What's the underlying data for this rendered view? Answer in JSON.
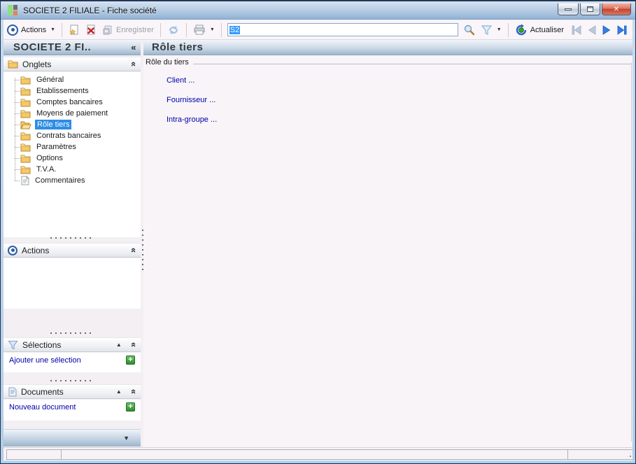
{
  "window": {
    "title": "SOCIETE 2 FILIALE -  Fiche société"
  },
  "toolbar": {
    "actions_label": "Actions",
    "save_label": "Enregistrer",
    "search_value": "S2",
    "actualiser_label": "Actualiser"
  },
  "sidebar": {
    "header_title": "SOCIETE 2 FI..",
    "sections": {
      "onglets": "Onglets",
      "actions": "Actions",
      "selections": "Sélections",
      "documents": "Documents"
    },
    "tree": [
      {
        "label": "Général"
      },
      {
        "label": "Etablissements"
      },
      {
        "label": "Comptes bancaires"
      },
      {
        "label": "Moyens de paiement"
      },
      {
        "label": "Rôle tiers",
        "selected": true
      },
      {
        "label": "Contrats bancaires"
      },
      {
        "label": "Paramètres"
      },
      {
        "label": "Options"
      },
      {
        "label": "T.V.A."
      },
      {
        "label": "Commentaires"
      }
    ],
    "selections_link": "Ajouter une sélection",
    "documents_link": "Nouveau document"
  },
  "content": {
    "header_title": "Rôle tiers",
    "groupbox_label": "Rôle du tiers",
    "links": [
      "Client ...",
      "Fournisseur ...",
      "Intra-groupe ..."
    ]
  },
  "colors": {
    "selection_blue": "#2e8de4",
    "link_navy": "#0000a8",
    "nav_enabled_blue": "#2f80e0",
    "nav_disabled_blue": "#b8c6da",
    "titlebar_top": "#d6e3f2",
    "titlebar_bottom": "#92b2d6",
    "close_red": "#c2422c",
    "plus_green": "#2f8f2f"
  }
}
